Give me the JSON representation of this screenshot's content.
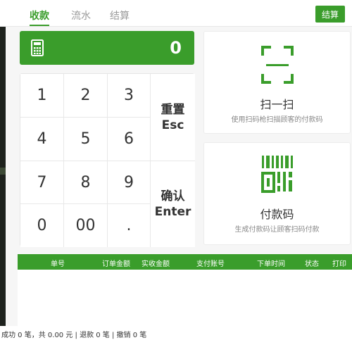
{
  "tabs": [
    {
      "label": "收款"
    },
    {
      "label": "流水"
    },
    {
      "label": "结算"
    }
  ],
  "settle_button": "结算",
  "amount": "0",
  "keys": {
    "k1": "1",
    "k2": "2",
    "k3": "3",
    "k4": "4",
    "k5": "5",
    "k6": "6",
    "k7": "7",
    "k8": "8",
    "k9": "9",
    "k0": "0",
    "k00": "00",
    "dot": "."
  },
  "reset": {
    "label": "重置",
    "key": "Esc"
  },
  "confirm": {
    "label": "确认",
    "key": "Enter"
  },
  "scan_card": {
    "title": "扫一扫",
    "subtitle": "使用扫码枪扫描顾客的付款码"
  },
  "code_card": {
    "title": "付款码",
    "subtitle": "生成付款码让顾客扫码付款"
  },
  "table": {
    "columns": [
      "单号",
      "订单金额",
      "实收金额",
      "支付账号",
      "下单时间",
      "状态",
      "打印"
    ]
  },
  "summary": "成功 0 笔，共 0.00 元 | 退款 0 笔 | 撤销 0 笔",
  "colors": {
    "accent": "#3a9d2b"
  },
  "icons": {
    "calculator": "calculator-icon",
    "scan": "scan-frame-icon",
    "code": "barcode-icon"
  }
}
